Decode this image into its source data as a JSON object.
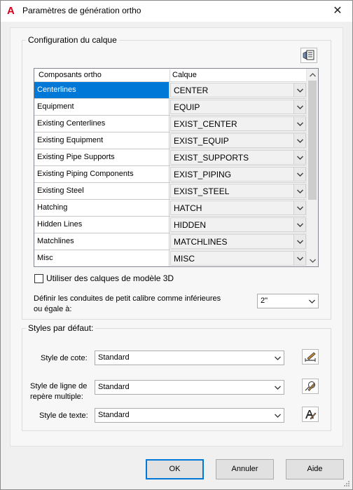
{
  "window": {
    "title": "Paramètres de génération ortho",
    "close_glyph": "✕"
  },
  "layer_config": {
    "group_label": "Configuration du calque",
    "columns": [
      "Composants ortho",
      "Calque"
    ],
    "rows": [
      {
        "component": "Centerlines",
        "layer": "CENTER",
        "selected": true
      },
      {
        "component": "Equipment",
        "layer": "EQUIP"
      },
      {
        "component": "Existing Centerlines",
        "layer": "EXIST_CENTER"
      },
      {
        "component": "Existing Equipment",
        "layer": "EXIST_EQUIP"
      },
      {
        "component": "Existing Pipe Supports",
        "layer": "EXIST_SUPPORTS"
      },
      {
        "component": "Existing Piping Components",
        "layer": "EXIST_PIPING"
      },
      {
        "component": "Existing Steel",
        "layer": "EXIST_STEEL"
      },
      {
        "component": "Hatching",
        "layer": "HATCH"
      },
      {
        "component": "Hidden Lines",
        "layer": "HIDDEN"
      },
      {
        "component": "Matchlines",
        "layer": "MATCHLINES"
      },
      {
        "component": "Misc",
        "layer": "MISC"
      }
    ],
    "use_template_layers_label": "Utiliser des calques de modèle 3D",
    "use_template_layers_checked": false,
    "small_bore_label_line1": "Définir les conduites de petit calibre comme inférieures",
    "small_bore_label_line2": "ou égale à:",
    "small_bore_value": "2\""
  },
  "default_styles": {
    "group_label": "Styles par défaut:",
    "dimension_style_label": "Style de cote:",
    "dimension_style_value": "Standard",
    "mleader_style_label_line1": "Style de ligne de",
    "mleader_style_label_line2": "repère multiple:",
    "mleader_style_value": "Standard",
    "text_style_label": "Style de texte:",
    "text_style_value": "Standard"
  },
  "buttons": {
    "ok": "OK",
    "cancel": "Annuler",
    "help": "Aide"
  },
  "colors": {
    "selection": "#0078d7",
    "accent_border": "#0078d7",
    "app_icon": "#d0021b"
  }
}
